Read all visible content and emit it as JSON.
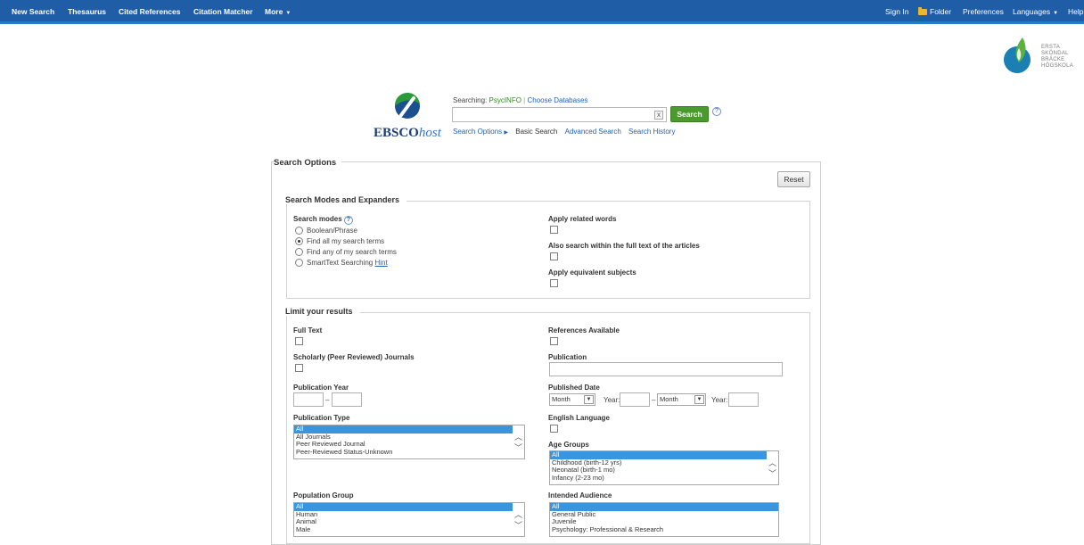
{
  "topnav": {
    "left": [
      "New Search",
      "Thesaurus",
      "Cited References",
      "Citation Matcher",
      "More"
    ],
    "right": {
      "signin": "Sign In",
      "folder": "Folder",
      "preferences": "Preferences",
      "languages": "Languages",
      "help": "Help"
    }
  },
  "brand_logo": {
    "lines": [
      "ERSTA",
      "SKÖNDAL",
      "BRÄCKE",
      "HÖGSKOLA"
    ]
  },
  "ebsco": {
    "wordmark_bold": "EBSCO",
    "wordmark_italic": "host"
  },
  "search": {
    "searching_label": "Searching:",
    "database": "PsycINFO",
    "choose_databases": "Choose Databases",
    "query_value": "",
    "clear": "x",
    "search_button": "Search",
    "help": "?",
    "links": {
      "options": "Search Options",
      "basic": "Basic Search",
      "advanced": "Advanced Search",
      "history": "Search History"
    }
  },
  "options": {
    "title": "Search Options",
    "reset": "Reset",
    "modes_section": "Search Modes and Expanders",
    "search_modes_label": "Search modes",
    "modes": [
      "Boolean/Phrase",
      "Find all my search terms",
      "Find any of my search terms",
      "SmartText Searching"
    ],
    "selected_mode": "Find all my search terms",
    "hint": "Hint",
    "expanders": [
      "Apply related words",
      "Also search within the full text of the articles",
      "Apply equivalent subjects"
    ],
    "limit_section": "Limit your results",
    "full_text": "Full Text",
    "scholarly": "Scholarly (Peer Reviewed) Journals",
    "pub_year": "Publication Year",
    "dash": "–",
    "pub_type": "Publication Type",
    "pub_type_options": [
      "All",
      "All Journals",
      "Peer Reviewed Journal",
      "Peer-Reviewed Status-Unknown"
    ],
    "population": "Population Group",
    "population_options": [
      "All",
      "Human",
      "Animal",
      "Male"
    ],
    "references": "References Available",
    "publication": "Publication",
    "published_date": "Published Date",
    "month": "Month",
    "year": "Year:",
    "english": "English Language",
    "age_groups": "Age Groups",
    "age_options": [
      "All",
      "Childhood (birth-12 yrs)",
      "Neonatal (birth-1 mo)",
      "Infancy (2-23 mo)"
    ],
    "audience": "Intended Audience",
    "audience_options": [
      "All",
      "General Public",
      "Juvenile",
      "Psychology: Professional & Research"
    ]
  }
}
